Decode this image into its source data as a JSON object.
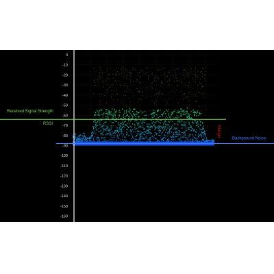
{
  "chart_data": {
    "type": "scatter",
    "title": "",
    "xlabel": "",
    "ylabel": "",
    "ylim": [
      -163,
      2
    ],
    "y_ticks": [
      0,
      -10,
      -20,
      -30,
      -40,
      -50,
      -60,
      -70,
      -80,
      -90,
      -100,
      -110,
      -120,
      -130,
      -140,
      -150,
      -160
    ],
    "grid": true,
    "signal_band": {
      "x_range_fraction": [
        0.0,
        1.0
      ],
      "top_dbm": -52,
      "bottom_dbm": -89,
      "notch_center_fraction": 0.52
    },
    "series": [
      {
        "name": "",
        "description_level": "signal"
      }
    ],
    "rssi_dbm": -64,
    "background_noise_dbm": -88,
    "colors": {
      "background": "#000000",
      "axis": "#ffffff",
      "grid": "#2a2a2a",
      "signal_high": "#2ad86a",
      "signal_low": "#1570e8",
      "rssi_line": "#7fd35a",
      "noise_line": "#3a78ff",
      "margin_label": "#cc2020"
    },
    "annotations": {
      "received_signal_strength": "Received Signal Strength",
      "rssi": "RSSI",
      "background_noise": "Background  Noise",
      "margin": "Margin"
    }
  }
}
